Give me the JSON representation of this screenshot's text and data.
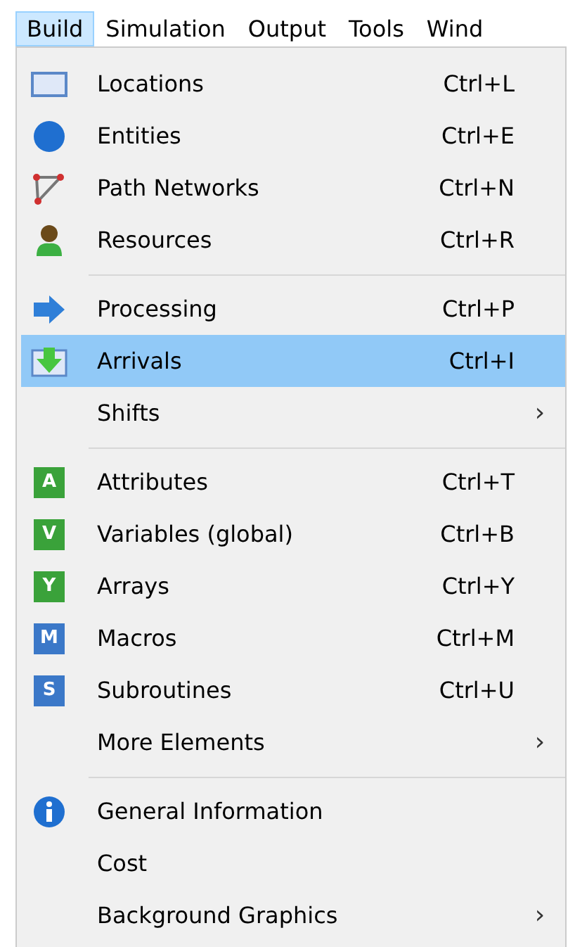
{
  "menubar": [
    {
      "label": "Build",
      "selected": true
    },
    {
      "label": "Simulation",
      "selected": false
    },
    {
      "label": "Output",
      "selected": false
    },
    {
      "label": "Tools",
      "selected": false
    },
    {
      "label": "Wind",
      "selected": false
    }
  ],
  "menu": {
    "sections": [
      {
        "items": [
          {
            "label": "Locations",
            "shortcut": "Ctrl+L",
            "selected": false,
            "icon": {
              "kind": "rectangle"
            }
          },
          {
            "label": "Entities",
            "shortcut": "Ctrl+E",
            "selected": false,
            "icon": {
              "kind": "ball"
            }
          },
          {
            "label": "Path Networks",
            "shortcut": "Ctrl+N",
            "selected": false,
            "icon": {
              "kind": "path"
            }
          },
          {
            "label": "Resources",
            "shortcut": "Ctrl+R",
            "selected": false,
            "icon": {
              "kind": "person"
            }
          }
        ]
      },
      {
        "items": [
          {
            "label": "Processing",
            "shortcut": "Ctrl+P",
            "selected": false,
            "icon": {
              "kind": "arrow-right"
            }
          },
          {
            "label": "Arrivals",
            "shortcut": "Ctrl+I",
            "selected": true,
            "icon": {
              "kind": "arrow-down"
            }
          },
          {
            "label": "Shifts",
            "submenu": "›",
            "selected": false
          }
        ]
      },
      {
        "items": [
          {
            "label": "Attributes",
            "shortcut": "Ctrl+T",
            "selected": false,
            "icon": {
              "kind": "letter",
              "letter": "A",
              "color": "#3aa23a"
            }
          },
          {
            "label": "Variables (global)",
            "shortcut": "Ctrl+B",
            "selected": false,
            "icon": {
              "kind": "letter",
              "letter": "V",
              "color": "#3aa23a"
            }
          },
          {
            "label": "Arrays",
            "shortcut": "Ctrl+Y",
            "selected": false,
            "icon": {
              "kind": "letter",
              "letter": "Y",
              "color": "#3aa23a"
            }
          },
          {
            "label": "Macros",
            "shortcut": "Ctrl+M",
            "selected": false,
            "icon": {
              "kind": "letter",
              "letter": "M",
              "color": "#3b78c8"
            }
          },
          {
            "label": "Subroutines",
            "shortcut": "Ctrl+U",
            "selected": false,
            "icon": {
              "kind": "letter",
              "letter": "S",
              "color": "#3b78c8"
            }
          },
          {
            "label": "More Elements",
            "submenu": "›",
            "selected": false
          }
        ]
      },
      {
        "items": [
          {
            "label": "General Information",
            "selected": false,
            "icon": {
              "kind": "info"
            }
          },
          {
            "label": "Cost",
            "selected": false
          },
          {
            "label": "Background Graphics",
            "submenu": "›",
            "selected": false
          }
        ]
      }
    ]
  }
}
